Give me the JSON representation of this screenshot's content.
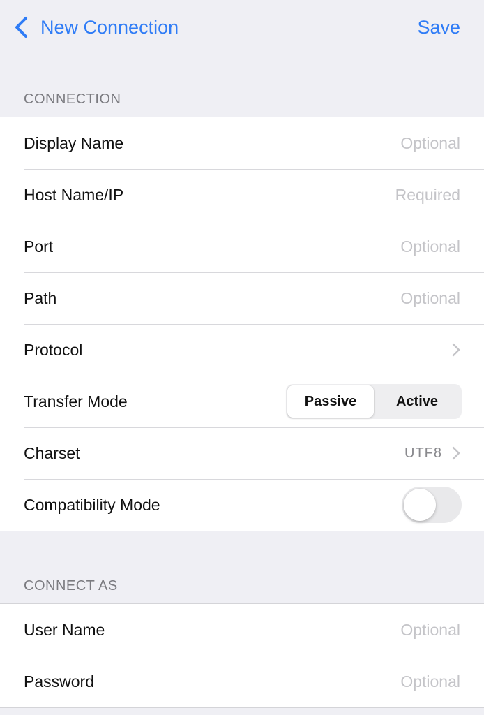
{
  "nav": {
    "back_label": "New Connection",
    "save_label": "Save"
  },
  "sections": {
    "connection": {
      "header": "CONNECTION",
      "display_name": {
        "label": "Display Name",
        "placeholder": "Optional"
      },
      "host": {
        "label": "Host Name/IP",
        "placeholder": "Required"
      },
      "port": {
        "label": "Port",
        "placeholder": "Optional"
      },
      "path": {
        "label": "Path",
        "placeholder": "Optional"
      },
      "protocol": {
        "label": "Protocol"
      },
      "transfer_mode": {
        "label": "Transfer Mode",
        "options": [
          "Passive",
          "Active"
        ],
        "selected": "Passive"
      },
      "charset": {
        "label": "Charset",
        "value": "UTF8"
      },
      "compatibility": {
        "label": "Compatibility Mode",
        "enabled": false
      }
    },
    "connect_as": {
      "header": "CONNECT AS",
      "user_name": {
        "label": "User Name",
        "placeholder": "Optional"
      },
      "password": {
        "label": "Password",
        "placeholder": "Optional"
      }
    }
  },
  "colors": {
    "accent": "#2f7cf6",
    "background": "#efeff4",
    "placeholder": "#c4c4c8"
  },
  "icons": {
    "back": "chevron-left-icon",
    "disclosure": "chevron-right-icon"
  }
}
